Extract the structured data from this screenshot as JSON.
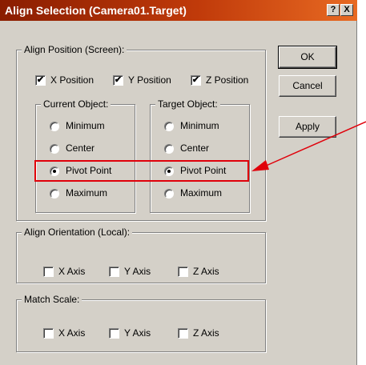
{
  "window": {
    "title": "Align Selection (Camera01.Target)",
    "help_label": "?",
    "close_label": "X"
  },
  "align_position": {
    "legend": "Align Position (Screen):",
    "x_label": "X Position",
    "y_label": "Y Position",
    "z_label": "Z Position",
    "x_checked": true,
    "y_checked": true,
    "z_checked": true
  },
  "current_object": {
    "legend": "Current Object:",
    "options": [
      "Minimum",
      "Center",
      "Pivot Point",
      "Maximum"
    ],
    "selected": "Pivot Point"
  },
  "target_object": {
    "legend": "Target Object:",
    "options": [
      "Minimum",
      "Center",
      "Pivot Point",
      "Maximum"
    ],
    "selected": "Pivot Point"
  },
  "align_orientation": {
    "legend": "Align Orientation (Local):",
    "x_label": "X Axis",
    "y_label": "Y Axis",
    "z_label": "Z Axis",
    "x_checked": false,
    "y_checked": false,
    "z_checked": false
  },
  "match_scale": {
    "legend": "Match Scale:",
    "x_label": "X Axis",
    "y_label": "Y Axis",
    "z_label": "Z Axis",
    "x_checked": false,
    "y_checked": false,
    "z_checked": false
  },
  "buttons": {
    "ok": "OK",
    "cancel": "Cancel",
    "apply": "Apply"
  },
  "colors": {
    "title_gradient_start": "#8a1d00",
    "title_gradient_end": "#e86a22",
    "dialog_face": "#d4d0c8",
    "annotation_red": "#e0000a"
  }
}
